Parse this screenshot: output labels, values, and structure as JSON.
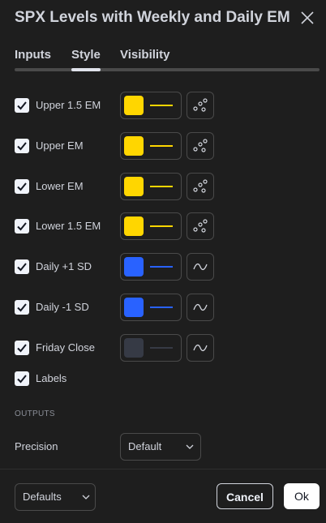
{
  "dialog": {
    "title": "SPX Levels with Weekly and Daily EM"
  },
  "tabs": [
    {
      "label": "Inputs"
    },
    {
      "label": "Style",
      "active": true
    },
    {
      "label": "Visibility"
    }
  ],
  "rows": [
    {
      "label": "Upper 1.5 EM",
      "checked": true,
      "color": "#ffd600",
      "style_icon": "dots-icon"
    },
    {
      "label": "Upper EM",
      "checked": true,
      "color": "#ffd600",
      "style_icon": "dots-icon"
    },
    {
      "label": "Lower EM",
      "checked": true,
      "color": "#ffd600",
      "style_icon": "dots-icon"
    },
    {
      "label": "Lower 1.5 EM",
      "checked": true,
      "color": "#ffd600",
      "style_icon": "dots-icon"
    },
    {
      "label": "Daily +1 SD",
      "checked": true,
      "color": "#2962ff",
      "style_icon": "line-icon"
    },
    {
      "label": "Daily -1 SD",
      "checked": true,
      "color": "#2962ff",
      "style_icon": "line-icon"
    },
    {
      "label": "Friday Close",
      "checked": true,
      "color": "#363a45",
      "style_icon": "line-icon"
    }
  ],
  "labels_option": {
    "label": "Labels",
    "checked": true
  },
  "outputs": {
    "section_title": "OUTPUTS",
    "precision_label": "Precision",
    "precision_value": "Default"
  },
  "footer": {
    "defaults_label": "Defaults",
    "cancel_label": "Cancel",
    "ok_label": "Ok"
  }
}
